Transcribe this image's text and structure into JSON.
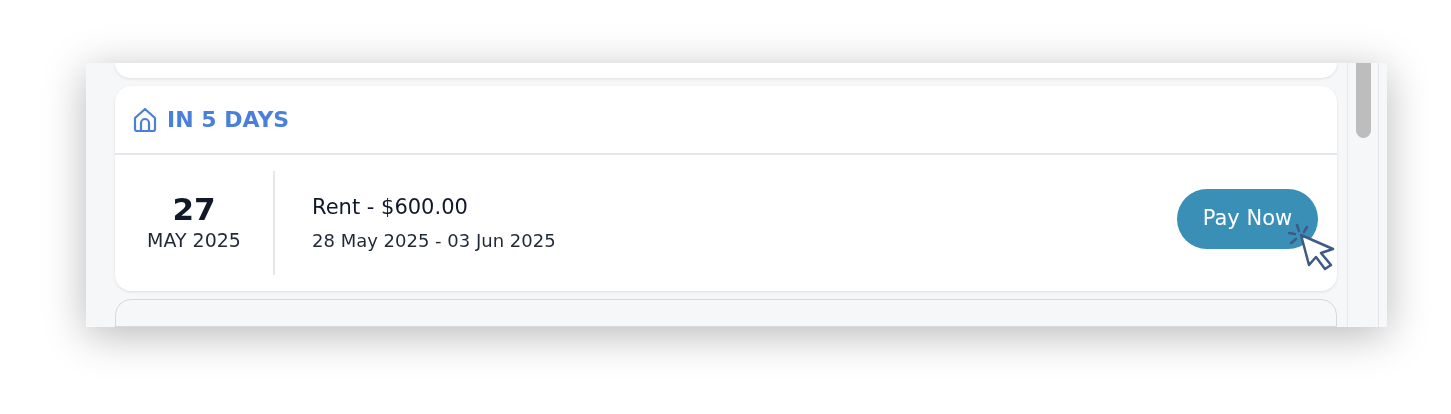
{
  "section": {
    "title": "IN 5 DAYS"
  },
  "payment": {
    "day": "27",
    "month_year": "MAY 2025",
    "title": "Rent - $600.00",
    "period": "28 May 2025 - 03 Jun 2025",
    "button": "Pay Now"
  }
}
